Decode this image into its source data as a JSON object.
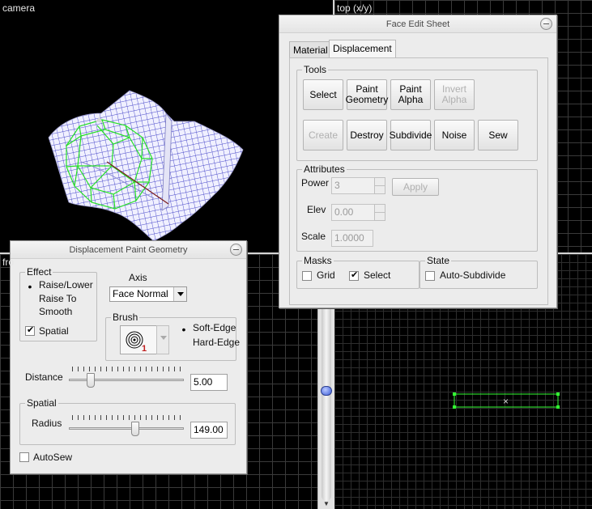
{
  "viewports": {
    "camera": {
      "title": "camera"
    },
    "top": {
      "title": "top (x/y)"
    },
    "front": {
      "title": "fro"
    }
  },
  "face_edit": {
    "title": "Face Edit Sheet",
    "tabs": [
      {
        "label": "Material"
      },
      {
        "label": "Displacement",
        "active": true
      }
    ],
    "tools": {
      "label": "Tools",
      "buttons": [
        {
          "label": "Select",
          "enabled": true
        },
        {
          "label": "Paint Geometry",
          "enabled": true
        },
        {
          "label": "Paint Alpha",
          "enabled": true
        },
        {
          "label": "Invert Alpha",
          "enabled": false
        },
        {
          "label": "Create",
          "enabled": false
        },
        {
          "label": "Destroy",
          "enabled": true
        },
        {
          "label": "Subdivide",
          "enabled": true
        },
        {
          "label": "Noise",
          "enabled": true
        },
        {
          "label": "Sew",
          "enabled": true
        }
      ]
    },
    "attributes": {
      "label": "Attributes",
      "power_label": "Power",
      "power_value": "3",
      "apply_label": "Apply",
      "elev_label": "Elev",
      "elev_value": "0.00",
      "scale_label": "Scale",
      "scale_value": "1.0000"
    },
    "masks": {
      "label": "Masks",
      "grid_label": "Grid",
      "grid_checked": false,
      "select_label": "Select",
      "select_checked": true
    },
    "state": {
      "label": "State",
      "auto_subdivide_label": "Auto-Subdivide",
      "auto_subdivide_checked": false
    }
  },
  "paint_geo": {
    "title": "Displacement Paint Geometry",
    "effect": {
      "label": "Effect",
      "options": [
        {
          "label": "Raise/Lower",
          "selected": true
        },
        {
          "label": "Raise To",
          "selected": false
        },
        {
          "label": "Smooth",
          "selected": false
        }
      ],
      "spatial_label": "Spatial",
      "spatial_checked": true
    },
    "axis": {
      "label": "Axis",
      "value": "Face Normal"
    },
    "brush": {
      "label": "Brush",
      "brush_number": "1",
      "soft_edge_label": "Soft-Edge",
      "soft_edge_selected": true,
      "hard_edge_label": "Hard-Edge",
      "hard_edge_selected": false
    },
    "distance": {
      "label": "Distance",
      "value": "5.00",
      "slider_fraction": 0.17
    },
    "spatial_group": {
      "label": "Spatial",
      "radius_label": "Radius",
      "radius_value": "149.00",
      "slider_fraction": 0.58
    },
    "autosew_label": "AutoSew",
    "autosew_checked": false
  },
  "colors": {
    "selection": "#33ff33",
    "mesh": "#3333cc"
  }
}
